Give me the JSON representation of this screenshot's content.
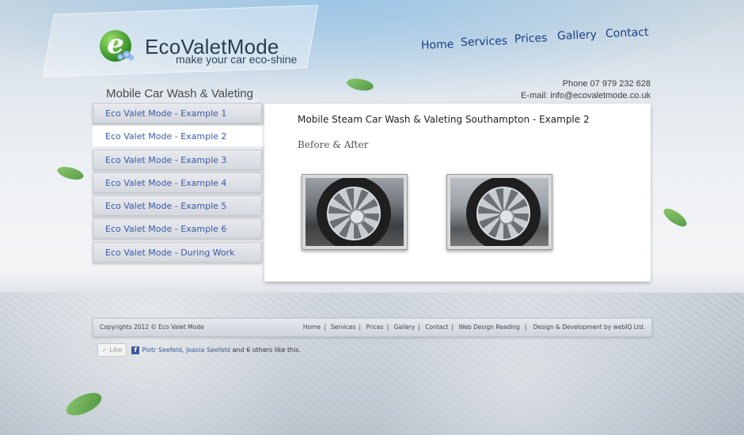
{
  "brand": {
    "name": "EcoValetMode",
    "tagline": "make your car eco-shine",
    "logo_letter": "e"
  },
  "nav": [
    {
      "label": "Home"
    },
    {
      "label": "Services"
    },
    {
      "label": "Prices"
    },
    {
      "label": "Gallery"
    },
    {
      "label": "Contact"
    }
  ],
  "section_title": "Mobile Car Wash & Valeting",
  "contact": {
    "phone": "Phone 07 979 232 628",
    "email": "E-mail: info@ecovaletmode.co.uk"
  },
  "sidebar": {
    "items": [
      {
        "label": "Eco Valet Mode - Example 1"
      },
      {
        "label": "Eco Valet Mode - Example 2",
        "active": true
      },
      {
        "label": "Eco Valet Mode - Example 3"
      },
      {
        "label": "Eco Valet Mode - Example 4"
      },
      {
        "label": "Eco Valet Mode - Example 5"
      },
      {
        "label": "Eco Valet Mode - Example 6"
      },
      {
        "label": "Eco Valet Mode - During Work"
      }
    ]
  },
  "content": {
    "title": "Mobile Steam Car Wash & Valeting Southampton - Example 2",
    "subtitle": "Before & After"
  },
  "footer": {
    "copyright": "Copyrights 2012 © Eco Valet Mode",
    "links": [
      "Home",
      "Services",
      "Prices",
      "Gallery",
      "Contact",
      "Web Design Reading"
    ],
    "credit": "Design & Development by webIQ Ltd."
  },
  "facebook": {
    "like_label": "Like",
    "names": "Piotr Seefeld, Joasia Seefeld",
    "others_text": "and 6 others like this."
  },
  "colors": {
    "link": "#3a59a8",
    "nav": "#1b3d86",
    "accent_green": "#3d8a2a"
  }
}
